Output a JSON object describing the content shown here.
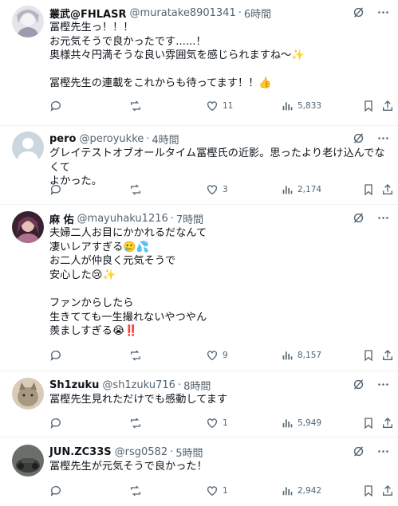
{
  "tweets": [
    {
      "name": "叢武@FHLASR",
      "handle": "@muratake8901341",
      "time": "6時間",
      "text": "冨樫先生っ！！！\nお元気そうで良かったです......！\n奥様共々円満そうな良い雰囲気を感じられますね〜✨\n\n冨樫先生の連載をこれからも待ってます！！👍",
      "replies": "",
      "retweets": "",
      "likes": "11",
      "views": "5,833",
      "avatar_color": "#c9c9cf"
    },
    {
      "name": "pero",
      "handle": "@peroyukke",
      "time": "4時間",
      "text": "グレイテストオブオールタイム冨樫氏の近影。思ったより老け込んでなくて\nよかった。",
      "replies": "",
      "retweets": "",
      "likes": "3",
      "views": "2,174",
      "avatar_color": "#ccd6dd"
    },
    {
      "name": "麻 佑",
      "handle": "@mayuhaku1216",
      "time": "7時間",
      "text": "夫婦二人お目にかかれるだなんて\n凄いレアすぎる🥲💦\nお二人が仲良く元気そうで\n安心した😢✨\n\nファンからしたら\n生きてても一生撮れないやつやん\n羨ましすぎる😭‼️",
      "replies": "",
      "retweets": "",
      "likes": "9",
      "views": "8,157",
      "avatar_color": "#5a2a3a"
    },
    {
      "name": "Sh1zuku",
      "handle": "@sh1zuku716",
      "time": "8時間",
      "text": "冨樫先生見れただけでも感動してます",
      "replies": "",
      "retweets": "",
      "likes": "1",
      "views": "5,949",
      "avatar_color": "#b8a890"
    },
    {
      "name": "JUN.ZC33S",
      "handle": "@rsg0582",
      "time": "5時間",
      "text": "冨樫先生が元気そうで良かった！",
      "replies": "",
      "retweets": "",
      "likes": "1",
      "views": "2,942",
      "avatar_color": "#4a4f4a"
    }
  ],
  "icons": {
    "grok": "grok-icon",
    "more": "more-icon",
    "reply": "reply-icon",
    "retweet": "retweet-icon",
    "like": "like-icon",
    "views": "views-icon",
    "bookmark": "bookmark-icon",
    "share": "share-icon"
  },
  "colors": {
    "text": "#0f1419",
    "secondary": "#536471",
    "divider": "#eff3f4"
  }
}
